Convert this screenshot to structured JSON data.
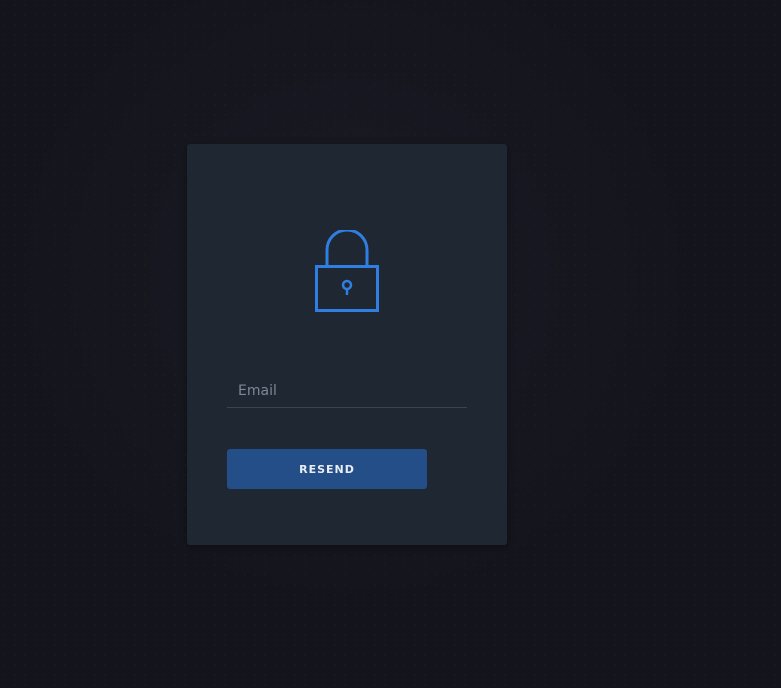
{
  "form": {
    "icon": "lock-icon",
    "email_placeholder": "Email",
    "email_value": "",
    "submit_label": "RESEND"
  },
  "colors": {
    "background": "#14141c",
    "card": "#1f2732",
    "accent": "#2f7fe2",
    "button": "#244e87"
  }
}
